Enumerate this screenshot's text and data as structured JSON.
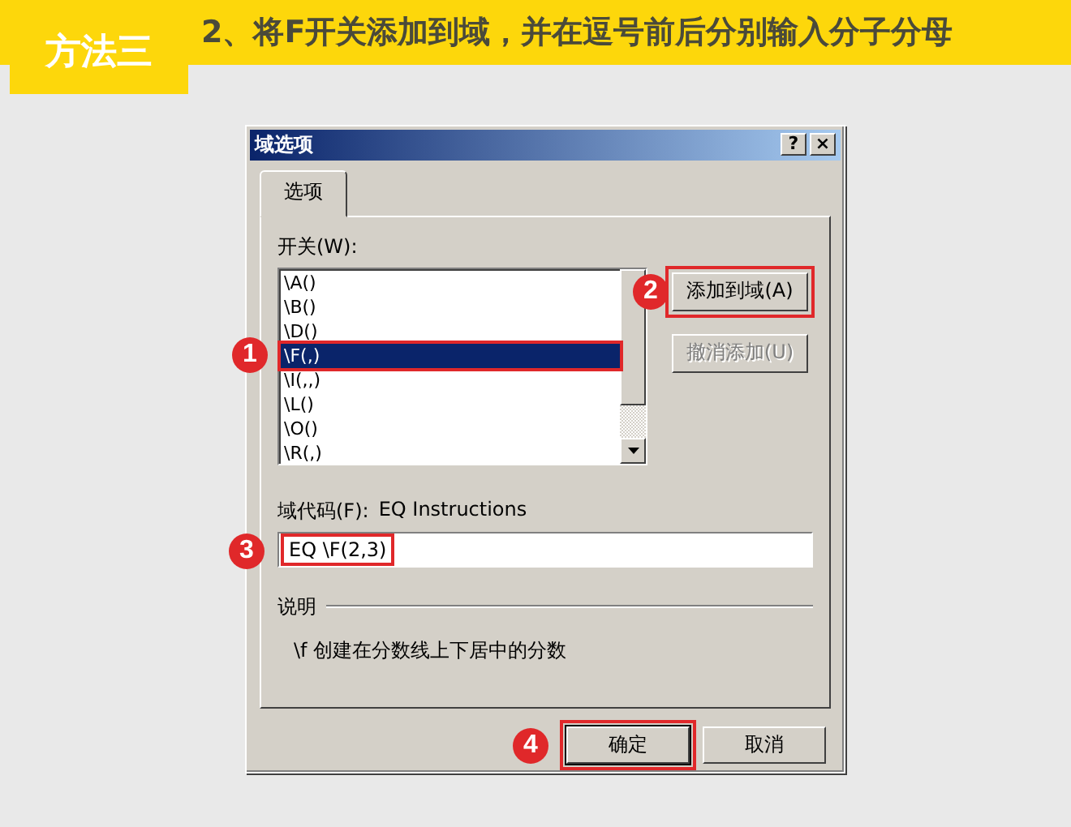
{
  "header": {
    "badge": "方法三",
    "title": "2、将F开关添加到域，并在逗号前后分别输入分子分母"
  },
  "window": {
    "title": "域选项",
    "help": "?",
    "close": "×"
  },
  "tabs": [
    {
      "label": "选项",
      "selected": true
    }
  ],
  "switches": {
    "label": "开关(W):",
    "items": [
      {
        "text": "\\A()",
        "selected": false
      },
      {
        "text": "\\B()",
        "selected": false
      },
      {
        "text": "\\D()",
        "selected": false
      },
      {
        "text": "\\F(,)",
        "selected": true,
        "step": "1"
      },
      {
        "text": "\\I(,,)",
        "selected": false
      },
      {
        "text": "\\L()",
        "selected": false
      },
      {
        "text": "\\O()",
        "selected": false
      },
      {
        "text": "\\R(,)",
        "selected": false
      }
    ]
  },
  "side_buttons": [
    {
      "label": "添加到域(A)",
      "disabled": false,
      "step": "2"
    },
    {
      "label": "撤消添加(U)",
      "disabled": true
    }
  ],
  "field_code": {
    "label": "域代码(F):",
    "name": "EQ Instructions",
    "value": "EQ \\F(2,3)",
    "step": "3"
  },
  "description": {
    "label": "说明",
    "text": "\\f 创建在分数线上下居中的分数"
  },
  "buttons": [
    {
      "label": "确定",
      "step": "4"
    },
    {
      "label": "取消"
    }
  ]
}
